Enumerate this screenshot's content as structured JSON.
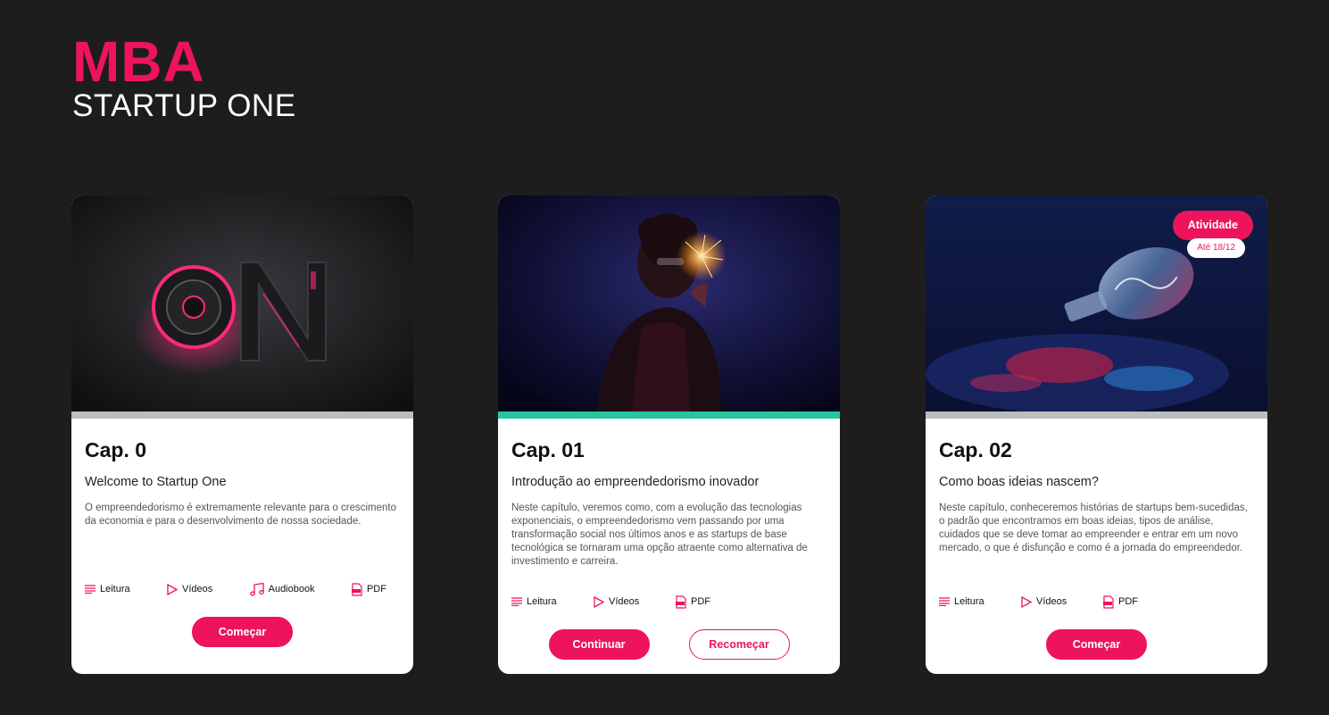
{
  "brand": {
    "title": "MBA",
    "subtitle": "STARTUP ONE"
  },
  "colors": {
    "accent": "#ed145b",
    "progress_active": "#26c6a0",
    "progress_idle": "#bdbdbd",
    "background": "#1d1d1d"
  },
  "cards": [
    {
      "chapter": "Cap. 0",
      "subtitle": "Welcome to Startup One",
      "description": "O empreendedorismo é extremamente relevante para o crescimento da economia e para o desenvolvimento de nossa sociedade.",
      "media": [
        {
          "label": "Leitura",
          "icon": "text-lines-icon"
        },
        {
          "label": "Vídeos",
          "icon": "play-icon"
        },
        {
          "label": "Audiobook",
          "icon": "music-note-icon"
        },
        {
          "label": "PDF",
          "icon": "pdf-icon"
        }
      ],
      "buttons": [
        {
          "label": "Começar"
        }
      ]
    },
    {
      "chapter": "Cap. 01",
      "subtitle": "Introdução ao empreendedorismo inovador",
      "description": "Neste capítulo, veremos como, com a evolução das tecnologias exponenciais, o empreendedorismo vem passando por uma transformação social nos últimos anos e as startups de base tecnológica se tornaram uma opção atraente como alternativa de investimento e carreira.",
      "media": [
        {
          "label": "Leitura",
          "icon": "text-lines-icon"
        },
        {
          "label": "Vídeos",
          "icon": "play-icon"
        },
        {
          "label": "PDF",
          "icon": "pdf-icon"
        }
      ],
      "buttons": [
        {
          "label": "Continuar"
        },
        {
          "label": "Recomeçar"
        }
      ]
    },
    {
      "chapter": "Cap. 02",
      "subtitle": "Como boas ideias nascem?",
      "description": "Neste capítulo, conheceremos histórias de startups bem-sucedidas, o padrão que encontramos em boas ideias, tipos de análise, cuidados que se deve tomar ao empreender e entrar em um novo mercado, o que é disfunção e como é a jornada do empreendedor.",
      "badge": "Atividade",
      "badge_date": "Até 18/12",
      "media": [
        {
          "label": "Leitura",
          "icon": "text-lines-icon"
        },
        {
          "label": "Vídeos",
          "icon": "play-icon"
        },
        {
          "label": "PDF",
          "icon": "pdf-icon"
        }
      ],
      "buttons": [
        {
          "label": "Começar"
        }
      ]
    }
  ]
}
